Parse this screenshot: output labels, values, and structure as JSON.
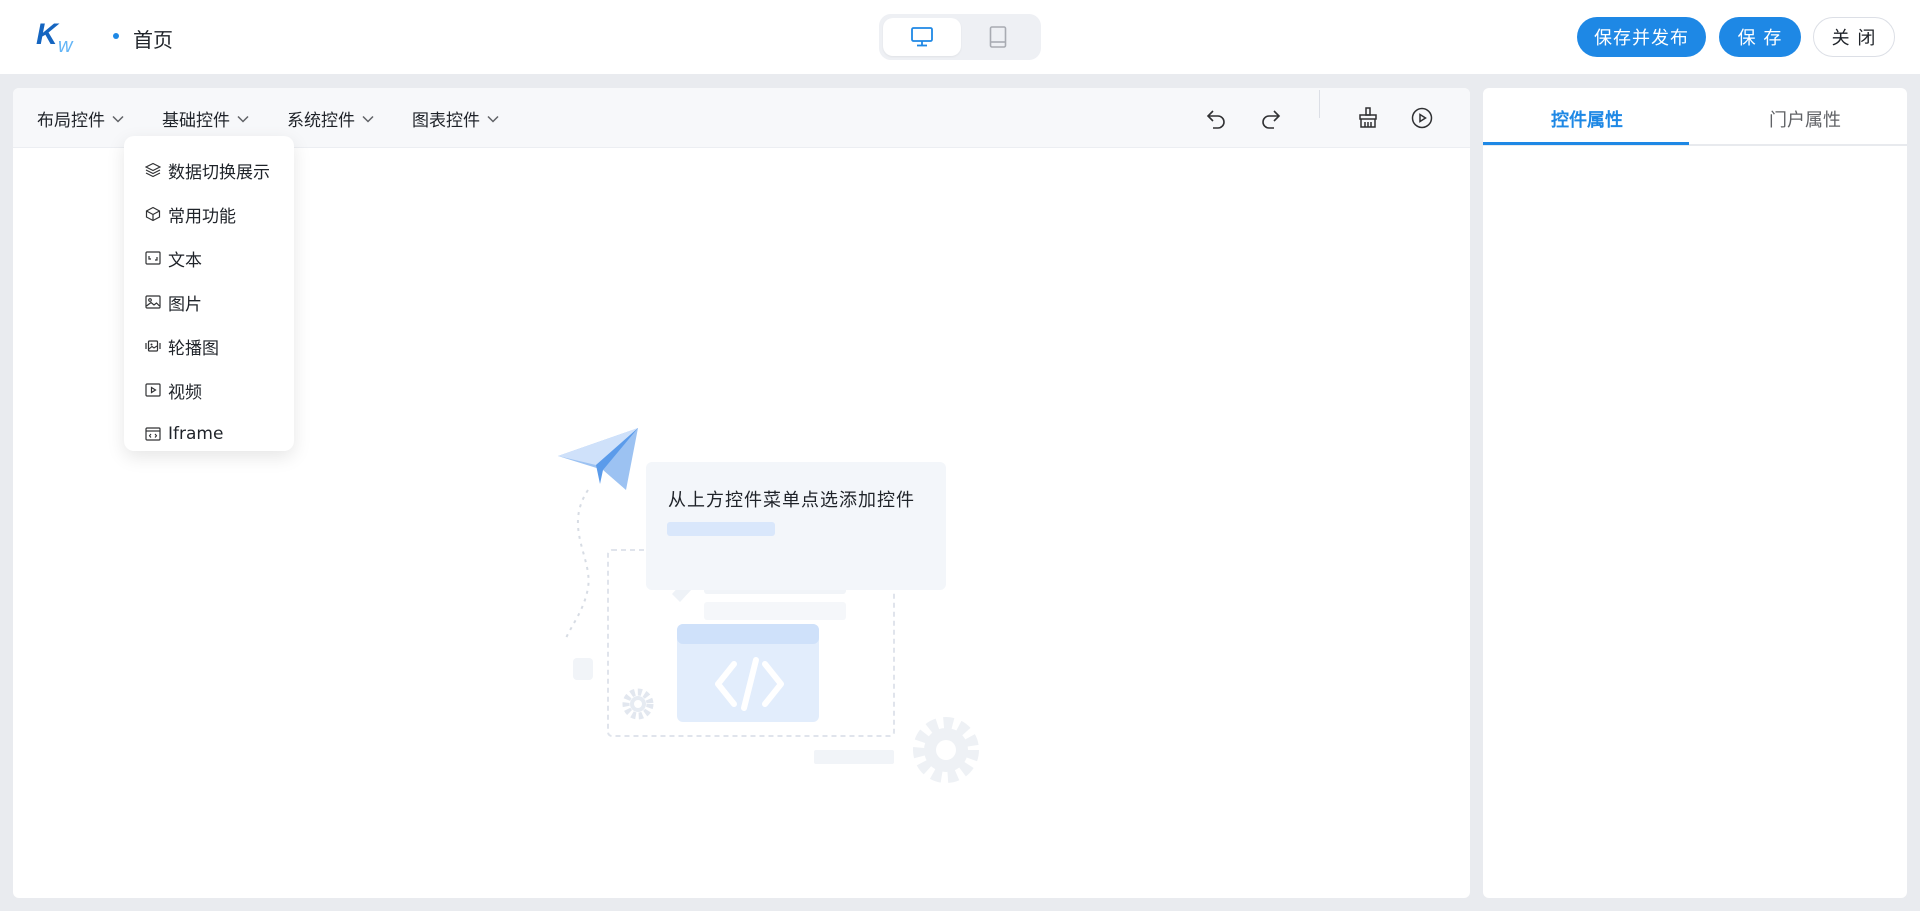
{
  "header": {
    "page_title": "首页",
    "device_options": [
      "desktop",
      "tablet"
    ],
    "buttons": {
      "publish": "保存并发布",
      "save": "保 存",
      "close": "关 闭"
    }
  },
  "toolbar": {
    "menus": [
      "布局控件",
      "基础控件",
      "系统控件",
      "图表控件"
    ],
    "icons": [
      "undo-icon",
      "redo-icon",
      "clear-brush-icon",
      "preview-play-icon"
    ]
  },
  "dropdown": {
    "items": [
      {
        "label": "数据切换展示",
        "icon": "layers-icon"
      },
      {
        "label": "常用功能",
        "icon": "cube-icon"
      },
      {
        "label": "文本",
        "icon": "text-box-icon"
      },
      {
        "label": "图片",
        "icon": "image-icon"
      },
      {
        "label": "轮播图",
        "icon": "carousel-icon"
      },
      {
        "label": "视频",
        "icon": "video-icon"
      },
      {
        "label": "Iframe",
        "icon": "iframe-icon"
      }
    ]
  },
  "empty_state": {
    "message": "从上方控件菜单点选添加控件"
  },
  "side_panel": {
    "tabs": [
      "控件属性",
      "门户属性"
    ],
    "active_tab": 0
  },
  "colors": {
    "primary": "#1e88e5",
    "background": "#e9ebef"
  }
}
